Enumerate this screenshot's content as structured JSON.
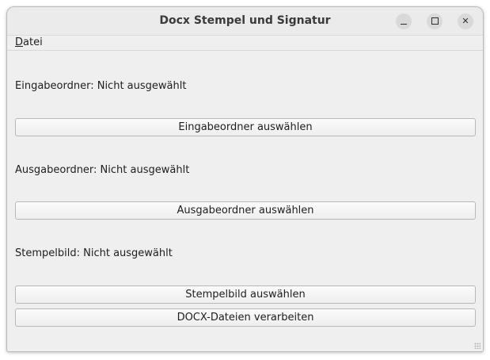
{
  "window": {
    "title": "Docx Stempel und Signatur"
  },
  "menu": {
    "file_accel": "D",
    "file_rest": "atei"
  },
  "input_folder": {
    "label": "Eingabeordner: Nicht ausgewählt",
    "button": "Eingabeordner auswählen"
  },
  "output_folder": {
    "label": "Ausgabeordner: Nicht ausgewählt",
    "button": "Ausgabeordner auswählen"
  },
  "stamp_image": {
    "label": "Stempelbild: Nicht ausgewählt",
    "button": "Stempelbild auswählen"
  },
  "process": {
    "button": "DOCX-Dateien verarbeiten"
  },
  "icons": {
    "minimize": "minimize-icon",
    "maximize": "maximize-icon",
    "close": "close-icon",
    "resize": "resize-grip-icon"
  },
  "colors": {
    "window_bg": "#efefef",
    "titlebar_bg": "#ebebeb",
    "text": "#1e1e1e",
    "button_border": "#b8b8b8"
  }
}
